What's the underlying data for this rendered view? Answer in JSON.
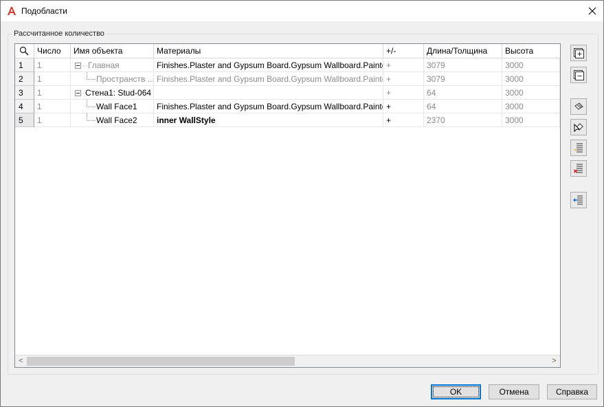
{
  "window": {
    "title": "Подобласти"
  },
  "group": {
    "label": "Рассчитанное количество"
  },
  "grid": {
    "columns": [
      "",
      "Число",
      "Имя объекта",
      "Материалы",
      "+/-",
      "Длина/Толщина",
      "Высота"
    ],
    "rows": [
      {
        "num": "1",
        "count": "1",
        "name": "Главная",
        "material": "Finishes.Plaster and Gypsum Board.Gypsum Wallboard.Painted",
        "sign": "+",
        "length": "3079",
        "height": "3000"
      },
      {
        "num": "2",
        "count": "1",
        "name": "Пространств ...",
        "material": "Finishes.Plaster and Gypsum Board.Gypsum Wallboard.Painted",
        "sign": "+",
        "length": "3079",
        "height": "3000"
      },
      {
        "num": "3",
        "count": "1",
        "name": "Стена1: Stud-064",
        "material": "",
        "sign": "+",
        "length": "64",
        "height": "3000"
      },
      {
        "num": "4",
        "count": "1",
        "name": "Wall Face1",
        "material": "Finishes.Plaster and Gypsum Board.Gypsum Wallboard.Painted",
        "sign": "+",
        "length": "64",
        "height": "3000"
      },
      {
        "num": "5",
        "count": "1",
        "name": "Wall Face2",
        "material": "inner WallStyle",
        "sign": "+",
        "length": "2370",
        "height": "3000"
      }
    ]
  },
  "scrollbar": {
    "left_arrow": "<",
    "right_arrow": ">"
  },
  "buttons": {
    "ok": "OK",
    "cancel": "Отмена",
    "help": "Справка"
  },
  "icons": {
    "app": "autocad-icon",
    "close": "close-icon",
    "search": "search-icon",
    "side": [
      "expand-all-icon",
      "collapse-all-icon",
      "select-objects-icon",
      "pick-objects-icon",
      "add-row-icon",
      "delete-row-icon",
      "import-icon"
    ]
  },
  "colors": {
    "accent": "#0078d7",
    "app_icon": "#d63a2a",
    "gray_text": "#8c8c8c"
  }
}
